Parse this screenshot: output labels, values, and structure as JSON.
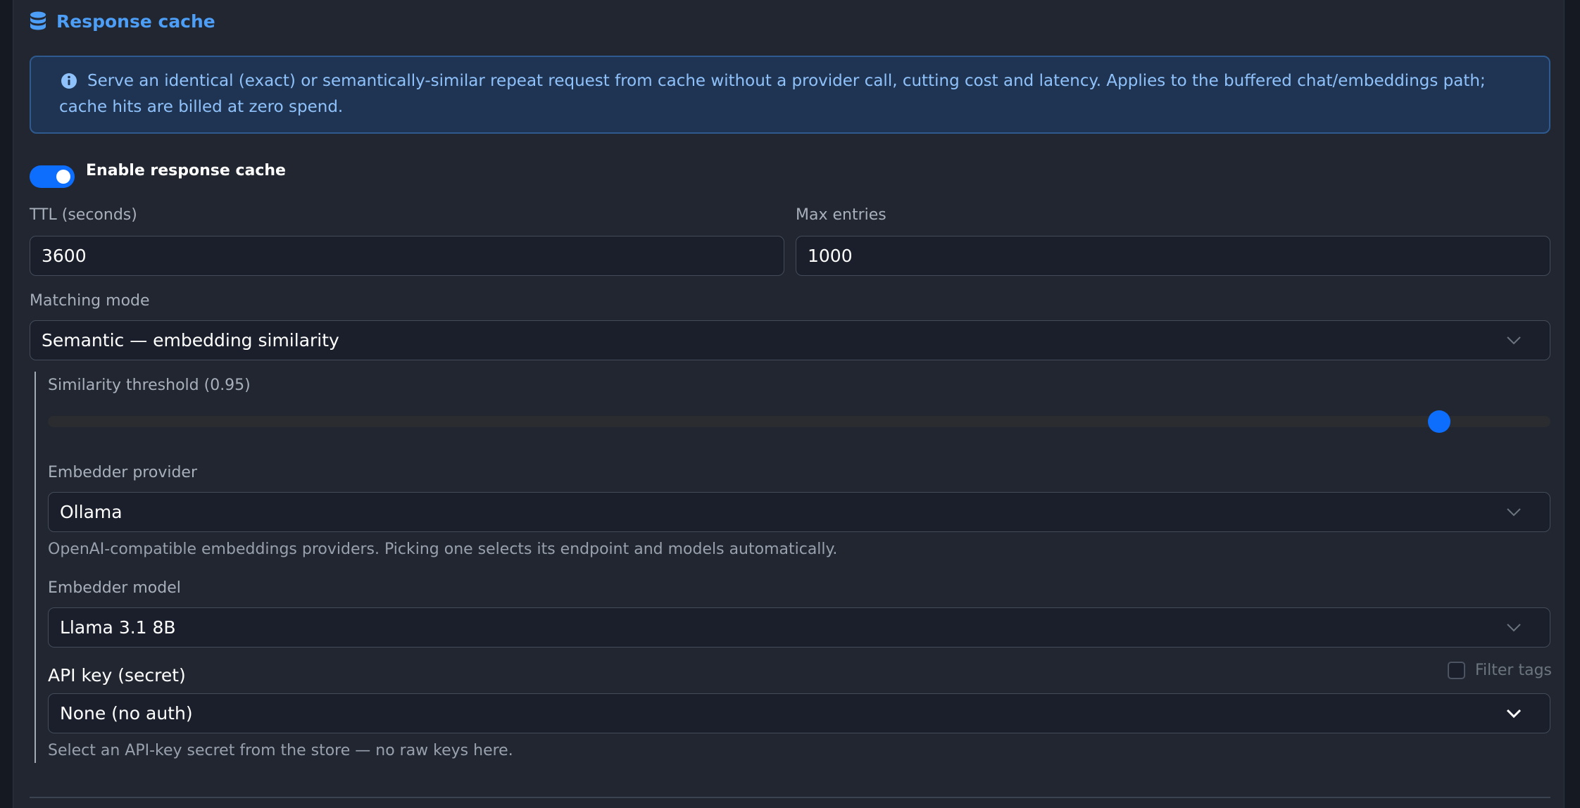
{
  "section": {
    "title": "Response cache",
    "icon": "database-icon"
  },
  "alert": {
    "icon": "info-circle-icon",
    "text": "Serve an identical (exact) or semantically-similar repeat request from cache without a provider call, cutting cost and latency. Applies to the buffered chat/embeddings path; cache hits are billed at zero spend."
  },
  "enable_toggle": {
    "label": "Enable response cache",
    "on": true
  },
  "ttl": {
    "label": "TTL (seconds)",
    "value": "3600"
  },
  "max_entries": {
    "label": "Max entries",
    "value": "1000"
  },
  "matching_mode": {
    "label": "Matching mode",
    "selected": "Semantic — embedding similarity"
  },
  "similarity": {
    "label": "Similarity threshold (0.95)",
    "value": 0.95,
    "min": 0,
    "max": 1
  },
  "embedder_provider": {
    "label": "Embedder provider",
    "selected": "Ollama",
    "help": "OpenAI-compatible embeddings providers. Picking one selects its endpoint and models automatically."
  },
  "embedder_model": {
    "label": "Embedder model",
    "selected": "Llama 3.1 8B"
  },
  "api_key": {
    "label": "API key (secret)",
    "filter_label": "Filter tags",
    "filter_checked": false,
    "selected": "None (no auth)",
    "help": "Select an API-key secret from the store — no raw keys here."
  },
  "colors": {
    "accent": "#0d6efd",
    "title": "#4d9ef7",
    "alert_bg": "#1f3452",
    "alert_text": "#8fc1fa",
    "panel_bg": "#212631"
  }
}
